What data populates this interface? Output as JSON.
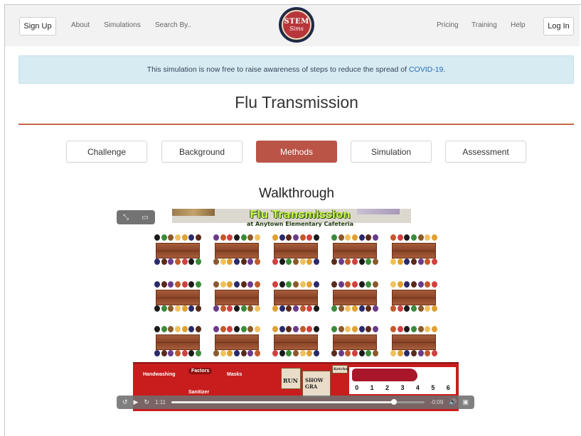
{
  "header": {
    "signup_label": "Sign Up",
    "nav_left": [
      "About",
      "Simulations",
      "Search By.."
    ],
    "logo_text": "STEM",
    "logo_sub": "Sims",
    "nav_right": [
      "Pricing",
      "Training",
      "Help"
    ],
    "login_label": "Log In"
  },
  "notice": {
    "text": "This simulation is now free to raise awareness of steps to reduce the spread of ",
    "link": "COVID-19",
    "suffix": "."
  },
  "page": {
    "title": "Flu Transmission",
    "tabs": [
      "Challenge",
      "Background",
      "Methods",
      "Simulation",
      "Assessment"
    ],
    "active_tab": "Methods",
    "section_title": "Walkthrough"
  },
  "video": {
    "frame_title": "Flu Transmission",
    "frame_subtitle": "at Anytown Elementary Cafeteria",
    "controls_labels": [
      "Handwashing",
      "Factors",
      "Masks",
      "Sanitizer"
    ],
    "buttons": [
      "RUN",
      "SHOW GRA",
      "Ketchup"
    ],
    "graph_ticks": [
      "0",
      "1",
      "2",
      "3",
      "4",
      "5",
      "6"
    ],
    "current_time": "1:11",
    "remaining_time": "-0:09",
    "progress": 0.88,
    "accent": "#b95447"
  }
}
